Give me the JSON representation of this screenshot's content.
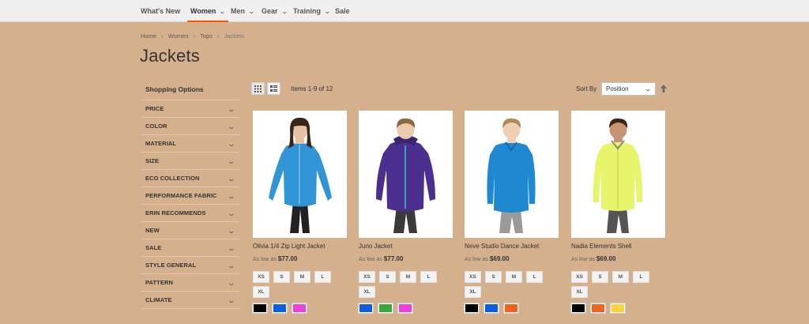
{
  "nav": {
    "items": [
      {
        "label": "What's New",
        "has_submenu": false,
        "active": false
      },
      {
        "label": "Women",
        "has_submenu": true,
        "active": true
      },
      {
        "label": "Men",
        "has_submenu": true,
        "active": false
      },
      {
        "label": "Gear",
        "has_submenu": true,
        "active": false
      },
      {
        "label": "Training",
        "has_submenu": true,
        "active": false
      },
      {
        "label": "Sale",
        "has_submenu": false,
        "active": false
      }
    ],
    "active_color": "#ff5501"
  },
  "breadcrumb": {
    "items": [
      "Home",
      "Women",
      "Tops"
    ],
    "current": "Jackets",
    "separator": "›"
  },
  "page_title": "Jackets",
  "sidebar": {
    "title": "Shopping Options",
    "filters": [
      "Price",
      "Color",
      "Material",
      "Size",
      "Eco Collection",
      "Performance Fabric",
      "Erin Recommends",
      "New",
      "Sale",
      "Style General",
      "Pattern",
      "Climate"
    ]
  },
  "toolbar": {
    "modes": [
      {
        "name": "grid",
        "icon": "grid-icon",
        "active": true
      },
      {
        "name": "list",
        "icon": "list-icon",
        "active": false
      }
    ],
    "amount": "Items 1-9 of 12",
    "sort_label": "Sort By",
    "sort_value": "Position",
    "sort_direction_icon": "arrow-up-icon"
  },
  "products": [
    {
      "name": "Olivia 1/4 Zip Light Jacket",
      "price_label": "As low as",
      "price": "$77.00",
      "jacket_color": "#2f95d6",
      "sizes": [
        "XS",
        "S",
        "M",
        "L",
        "XL"
      ],
      "swatches": [
        "#000000",
        "#0a5ce0",
        "#ef3fdc"
      ]
    },
    {
      "name": "Juno Jacket",
      "price_label": "As low as",
      "price": "$77.00",
      "jacket_color": "#4b2f8f",
      "sizes": [
        "XS",
        "S",
        "M",
        "L",
        "XL"
      ],
      "swatches": [
        "#0a5ce0",
        "#3aa53a",
        "#ef3fdc"
      ]
    },
    {
      "name": "Neve Studio Dance Jacket",
      "price_label": "As low as",
      "price": "$69.00",
      "jacket_color": "#1e88d0",
      "sizes": [
        "XS",
        "S",
        "M",
        "L",
        "XL"
      ],
      "swatches": [
        "#000000",
        "#0a5ce0",
        "#f0621e"
      ]
    },
    {
      "name": "Nadia Elements Shell",
      "price_label": "As low as",
      "price": "$69.00",
      "jacket_color": "#e6f56a",
      "sizes": [
        "XS",
        "S",
        "M",
        "L",
        "XL"
      ],
      "swatches": [
        "#000000",
        "#f0621e",
        "#ffd13a"
      ]
    }
  ]
}
